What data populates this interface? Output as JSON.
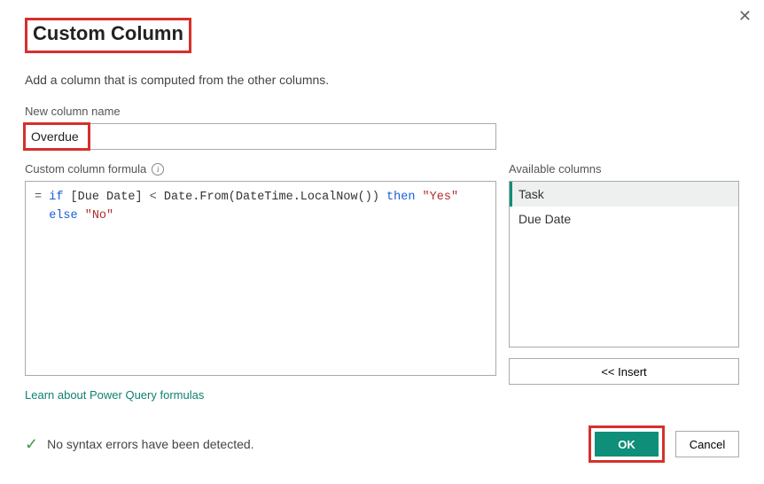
{
  "dialog": {
    "title": "Custom Column",
    "subtitle": "Add a column that is computed from the other columns.",
    "close_glyph": "✕"
  },
  "column_name": {
    "label": "New column name",
    "value": "Overdue"
  },
  "formula": {
    "label": "Custom column formula",
    "tokens": {
      "eq": "=",
      "if": "if",
      "col": "[Due Date]",
      "lt": "<",
      "fn": "Date.From(DateTime.LocalNow())",
      "then": "then",
      "yes": "\"Yes\"",
      "else": "else",
      "no": "\"No\""
    }
  },
  "available": {
    "label": "Available columns",
    "items": [
      "Task",
      "Due Date"
    ],
    "selected_index": 0,
    "insert_label": "<< Insert"
  },
  "learn_link": "Learn about Power Query formulas",
  "status": {
    "check": "✓",
    "text": "No syntax errors have been detected."
  },
  "buttons": {
    "ok": "OK",
    "cancel": "Cancel"
  }
}
